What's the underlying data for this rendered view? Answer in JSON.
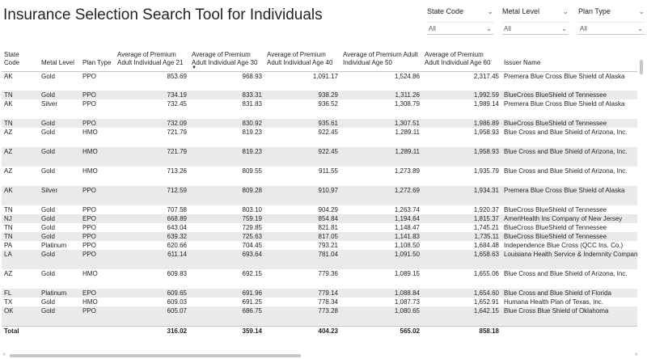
{
  "title": "Insurance Selection Search Tool for Individuals",
  "slicers": [
    {
      "label": "State Code",
      "value": "All"
    },
    {
      "label": "Metal Level",
      "value": "All"
    },
    {
      "label": "Plan Type",
      "value": "All"
    }
  ],
  "table": {
    "headers": {
      "state": "State Code",
      "metal": "Metal Level",
      "plan": "Plan Type",
      "p21": "Average of Premium Adult Individual Age 21",
      "p30": "Average of Premium Adult Individual Age 30",
      "p40": "Average of Premium Adult Individual Age 40",
      "p50": "Average of Premium Adult Individual Age 50",
      "p60": "Average of Premium Adult Individual Age 60",
      "issuer": "Issuer Name"
    },
    "sorted_column": "p30",
    "rows": [
      [
        "AK",
        "Gold",
        "PPO",
        "853.69",
        "968.93",
        "1,091.17",
        "1,524.86",
        "2,317.45",
        "Premera Blue Cross Blue Shield of Alaska"
      ],
      [
        "TN",
        "Gold",
        "PPO",
        "734.19",
        "833.31",
        "938.29",
        "1,311.26",
        "1,992.59",
        "BlueCross BlueShield of Tennessee"
      ],
      [
        "AK",
        "Silver",
        "PPO",
        "732.45",
        "831.83",
        "936.52",
        "1,308.79",
        "1,989.14",
        "Premera Blue Cross Blue Shield of Alaska"
      ],
      [
        "TN",
        "Gold",
        "PPO",
        "732.09",
        "830.92",
        "935.61",
        "1,307.51",
        "1,986.89",
        "BlueCross BlueShield of Tennessee"
      ],
      [
        "AZ",
        "Gold",
        "HMO",
        "721.79",
        "819.23",
        "922.45",
        "1,289.11",
        "1,958.93",
        "Blue Cross and Blue Shield of Arizona, Inc."
      ],
      [
        "AZ",
        "Gold",
        "HMO",
        "721.79",
        "819.23",
        "922.45",
        "1,289.11",
        "1,958.93",
        "Blue Cross and Blue Shield of Arizona, Inc."
      ],
      [
        "AZ",
        "Gold",
        "HMO",
        "713.26",
        "809.55",
        "911.55",
        "1,273.89",
        "1,935.79",
        "Blue Cross and Blue Shield of Arizona, Inc."
      ],
      [
        "AK",
        "Silver",
        "PPO",
        "712.59",
        "809.28",
        "910.97",
        "1,272.69",
        "1,934.31",
        "Premera Blue Cross Blue Shield of Alaska"
      ],
      [
        "TN",
        "Gold",
        "PPO",
        "707.58",
        "803.10",
        "904.29",
        "1,263.74",
        "1,920.37",
        "BlueCross BlueShield of Tennessee"
      ],
      [
        "NJ",
        "Gold",
        "EPO",
        "668.89",
        "759.19",
        "854.84",
        "1,194.64",
        "1,815.37",
        "AmeriHealth Ins Company of New Jersey"
      ],
      [
        "TN",
        "Gold",
        "PPO",
        "643.04",
        "729.85",
        "821.81",
        "1,148.47",
        "1,745.21",
        "BlueCross BlueShield of Tennessee"
      ],
      [
        "TN",
        "Gold",
        "PPO",
        "639.32",
        "725.63",
        "817.05",
        "1,141.83",
        "1,735.11",
        "BlueCross BlueShield of Tennessee"
      ],
      [
        "PA",
        "Platinum",
        "PPO",
        "620.66",
        "704.45",
        "793.21",
        "1,108.50",
        "1,684.48",
        "Independence Blue Cross (QCC Ins. Co.)"
      ],
      [
        "LA",
        "Gold",
        "PPO",
        "611.14",
        "693.64",
        "781.04",
        "1,091.50",
        "1,658.63",
        "Louisiana Health Service & Indemnity Company"
      ],
      [
        "AZ",
        "Gold",
        "HMO",
        "609.83",
        "692.15",
        "779.36",
        "1,089.15",
        "1,655.06",
        "Blue Cross and Blue Shield of Arizona, Inc."
      ],
      [
        "FL",
        "Platinum",
        "EPO",
        "609.65",
        "691.96",
        "779.14",
        "1,088.84",
        "1,654.60",
        "Blue Cross and Blue Shield of Florida"
      ],
      [
        "TX",
        "Gold",
        "HMO",
        "609.03",
        "691.25",
        "778.34",
        "1,087.73",
        "1,652.91",
        "Humana Health Plan of Texas, Inc."
      ],
      [
        "OK",
        "Gold",
        "PPO",
        "605.07",
        "686.75",
        "773.28",
        "1,080.65",
        "1,642.15",
        "Blue Cross Blue Shield of Oklahoma"
      ]
    ],
    "total": {
      "label": "Total",
      "p21": "316.02",
      "p30": "359.14",
      "p40": "404.23",
      "p50": "565.02",
      "p60": "858.18"
    }
  },
  "colors": {
    "band": "#eaeaea",
    "text": "#252423",
    "border": "#c8c6c4"
  }
}
